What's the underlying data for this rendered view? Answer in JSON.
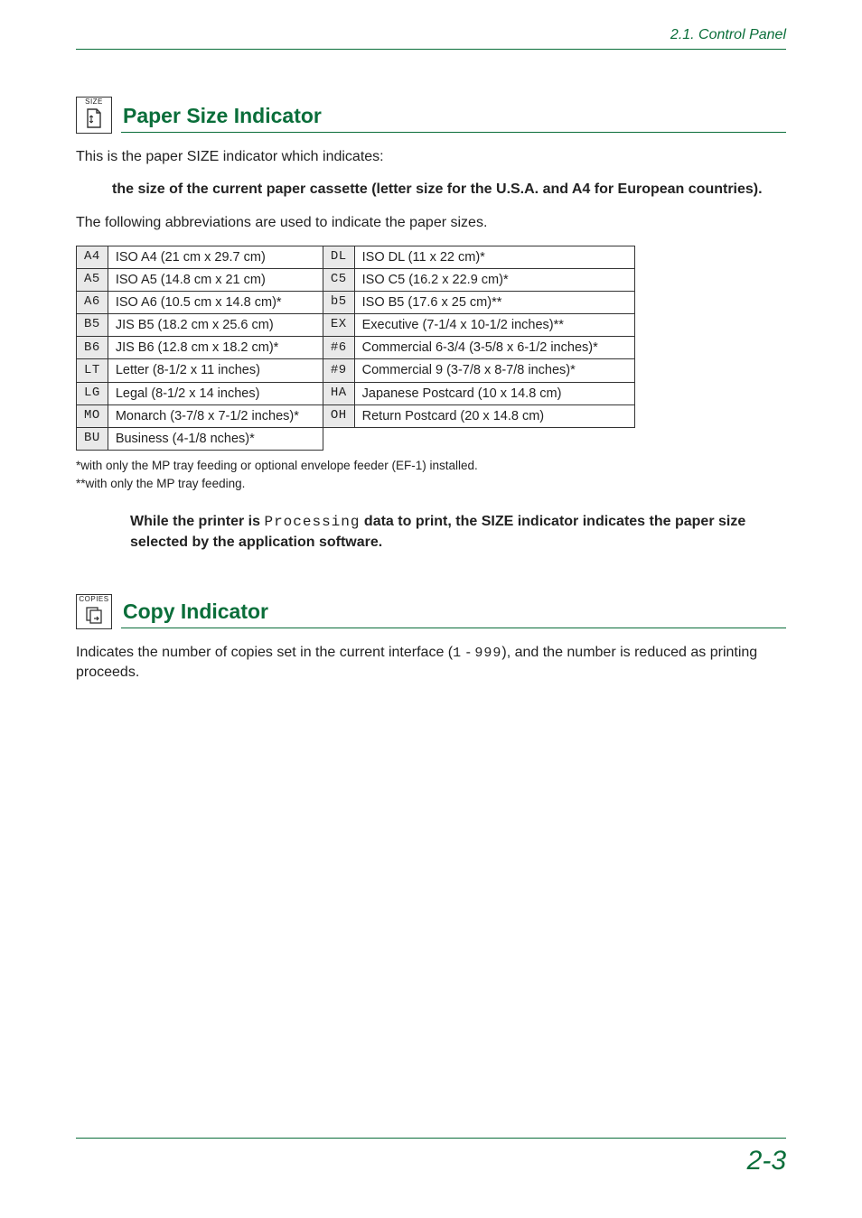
{
  "running_head": "2.1. Control Panel",
  "page_number": "2-3",
  "size_section": {
    "icon_label": "SIZE",
    "heading": "Paper Size Indicator",
    "intro": "This is the paper SIZE indicator which indicates:",
    "indent": "the size of the current paper cassette (letter size for the U.S.A. and A4 for European countries).",
    "lead": "The following abbreviations are used to indicate the paper sizes.",
    "rows": [
      {
        "c1": "A4",
        "d1": "ISO A4 (21 cm x 29.7 cm)",
        "c2": "DL",
        "d2": "ISO DL (11 x 22 cm)*"
      },
      {
        "c1": "A5",
        "d1": "ISO A5 (14.8 cm x 21 cm)",
        "c2": "C5",
        "d2": "ISO C5 (16.2 x 22.9 cm)*"
      },
      {
        "c1": "A6",
        "d1": "ISO A6 (10.5 cm x 14.8 cm)*",
        "c2": "b5",
        "d2": "ISO B5 (17.6 x 25 cm)**"
      },
      {
        "c1": "B5",
        "d1": "JIS B5 (18.2 cm x 25.6 cm)",
        "c2": "EX",
        "d2": "Executive (7-1/4 x 10-1/2 inches)**"
      },
      {
        "c1": "B6",
        "d1": "JIS B6 (12.8 cm x 18.2 cm)*",
        "c2": "#6",
        "d2": "Commercial 6-3/4 (3-5/8 x 6-1/2 inches)*"
      },
      {
        "c1": "LT",
        "d1": "Letter (8-1/2 x 11 inches)",
        "c2": "#9",
        "d2": "Commercial 9 (3-7/8 x 8-7/8 inches)*"
      },
      {
        "c1": "LG",
        "d1": "Legal (8-1/2 x 14 inches)",
        "c2": "HA",
        "d2": "Japanese Postcard (10 x 14.8 cm)"
      },
      {
        "c1": "MO",
        "d1": "Monarch (3-7/8 x 7-1/2 inches)*",
        "c2": "OH",
        "d2": "Return Postcard (20 x 14.8 cm)"
      },
      {
        "c1": "BU",
        "d1": "Business (4-1/8 nches)*"
      }
    ],
    "foot1": "*with only the MP tray feeding or optional envelope feeder (EF-1) installed.",
    "foot2": "**with only the MP tray feeding.",
    "note_pre": "While the printer is ",
    "note_mono": "Processing",
    "note_post": " data to print, the SIZE indicator indicates the paper size selected by the application software."
  },
  "copy_section": {
    "icon_label": "COPIES",
    "heading": "Copy Indicator",
    "body_pre": "Indicates the number of copies set in the current interface (",
    "body_mono1": "1",
    "body_mid": " - ",
    "body_mono2": "999",
    "body_post": "), and the number is reduced as printing proceeds."
  }
}
